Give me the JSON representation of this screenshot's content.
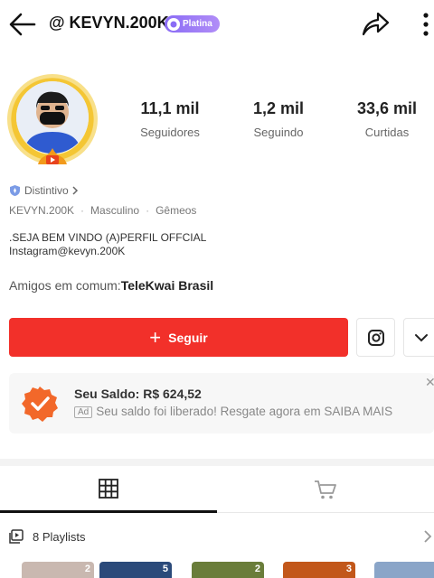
{
  "header": {
    "username": "@ KEVYN.200K",
    "badge_label": "Platina"
  },
  "stats": [
    {
      "value": "11,1 mil",
      "label": "Seguidores"
    },
    {
      "value": "1,2 mil",
      "label": "Seguindo"
    },
    {
      "value": "33,6 mil",
      "label": "Curtidas"
    }
  ],
  "profile": {
    "distintivo": "Distintivo",
    "handle": "KEVYN.200K",
    "gender": "Masculino",
    "sign": "Gêmeos",
    "bio_line1": ".SEJA BEM VINDO (A)PERFIL OFFCIAL",
    "bio_line2": "Instagram@kevyn.200K",
    "friends_prefix": "Amigos em comum:",
    "friends_name": "TeleKwai Brasil"
  },
  "actions": {
    "follow_label": "Seguir"
  },
  "ad": {
    "title": "Seu Saldo: R$ 624,52",
    "tag": "Ad",
    "text": "Seu saldo foi liberado! Resgate agora em SAIBA MAIS"
  },
  "tabs": [
    {
      "name": "grid",
      "icon": "grid-icon"
    },
    {
      "name": "shop",
      "icon": "cart-icon"
    }
  ],
  "playlists": {
    "label": "8 Playlists",
    "thumbs": [
      {
        "count": "2",
        "color": "#c9b8b0"
      },
      {
        "count": "5",
        "color": "#2b4a7a"
      },
      {
        "count": "2",
        "color": "#6a7d3a"
      },
      {
        "count": "3",
        "color": "#c2571a"
      },
      {
        "count": "",
        "color": "#8aa5c8"
      }
    ]
  },
  "colors": {
    "accent": "#f2302a",
    "badge": "#8a6cf5"
  }
}
